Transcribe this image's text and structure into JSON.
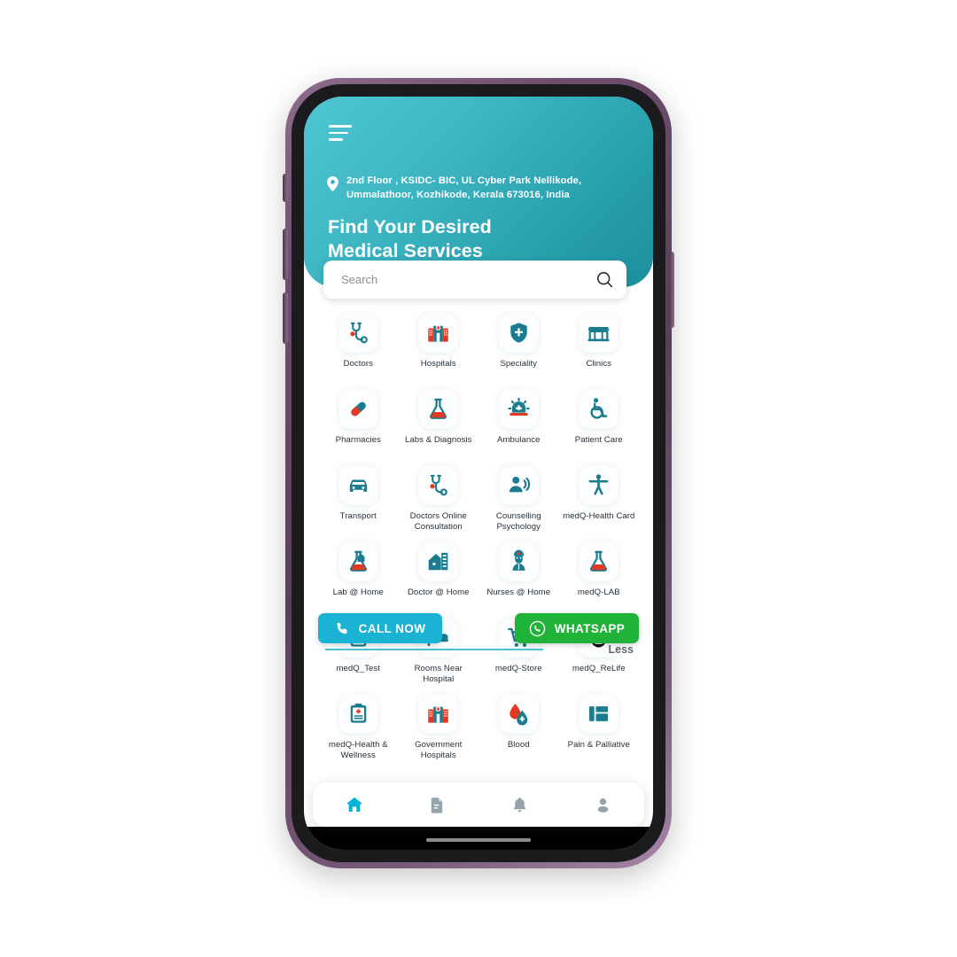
{
  "app": {
    "header": {
      "menu_icon": "hamburger-menu-icon",
      "location_icon": "map-pin-icon",
      "address": "2nd Floor , KSIDC- BIC, UL Cyber Park Nellikode, Ummalathoor, Kozhikode, Kerala 673016, India",
      "headline_line1": "Find Your Desired",
      "headline_line2": "Medical Services",
      "gradient_from": "#4fc6d4",
      "gradient_to": "#1d8f9e"
    },
    "search": {
      "placeholder": "Search",
      "value": "",
      "icon": "search-icon"
    },
    "services": [
      {
        "label": "Doctors",
        "icon": "stethoscope-icon"
      },
      {
        "label": "Hospitals",
        "icon": "hospital-building-icon"
      },
      {
        "label": "Speciality",
        "icon": "shield-cross-icon"
      },
      {
        "label": "Clinics",
        "icon": "storefront-icon"
      },
      {
        "label": "Pharmacies",
        "icon": "pill-capsule-icon"
      },
      {
        "label": "Labs & Diagnosis",
        "icon": "lab-flask-icon"
      },
      {
        "label": "Ambulance",
        "icon": "ambulance-siren-icon"
      },
      {
        "label": "Patient Care",
        "icon": "wheelchair-icon"
      },
      {
        "label": "Transport",
        "icon": "car-icon"
      },
      {
        "label": "Doctors Online Consultation",
        "icon": "stethoscope-icon"
      },
      {
        "label": "Counselling Psychology",
        "icon": "person-speaking-icon"
      },
      {
        "label": "medQ-Health Card",
        "icon": "accessibility-person-icon"
      },
      {
        "label": "Lab @ Home",
        "icon": "flask-home-icon"
      },
      {
        "label": "Doctor @ Home",
        "icon": "house-medical-icon"
      },
      {
        "label": "Nurses @ Home",
        "icon": "nurse-icon"
      },
      {
        "label": "medQ-LAB",
        "icon": "lab-flask-icon"
      },
      {
        "label": "medQ_Test",
        "icon": "clipboard-check-icon"
      },
      {
        "label": "Rooms Near Hospital",
        "icon": "hospital-bed-icon"
      },
      {
        "label": "medQ-Store",
        "icon": "shopping-cart-plus-icon"
      },
      {
        "label": "medQ_ReLife",
        "icon": "droplet-person-icon"
      },
      {
        "label": "medQ-Health & Wellness",
        "icon": "clipboard-plus-icon"
      },
      {
        "label": "Government Hospitals",
        "icon": "hospital-building-icon"
      },
      {
        "label": "Blood",
        "icon": "blood-drops-icon"
      },
      {
        "label": "Pain & Palliative",
        "icon": "grid-layout-icon"
      }
    ],
    "actions": {
      "call_label": "CALL NOW",
      "call_icon": "phone-icon",
      "call_color": "#1bb3d4",
      "whatsapp_label": "WHATSAPP",
      "whatsapp_icon": "whatsapp-icon",
      "whatsapp_color": "#20b33a"
    },
    "show_less_label": "Less",
    "bottom_nav": [
      {
        "name": "home",
        "icon": "home-icon",
        "active": true
      },
      {
        "name": "records",
        "icon": "document-icon",
        "active": false
      },
      {
        "name": "notifications",
        "icon": "bell-icon",
        "active": false
      },
      {
        "name": "profile",
        "icon": "person-icon",
        "active": false
      }
    ],
    "colors": {
      "accent_teal": "#1d8f9e",
      "icon_teal": "#1b7c8f",
      "icon_red": "#e03a25",
      "nav_active": "#00b4d8",
      "nav_inactive": "#93a4ab"
    }
  }
}
